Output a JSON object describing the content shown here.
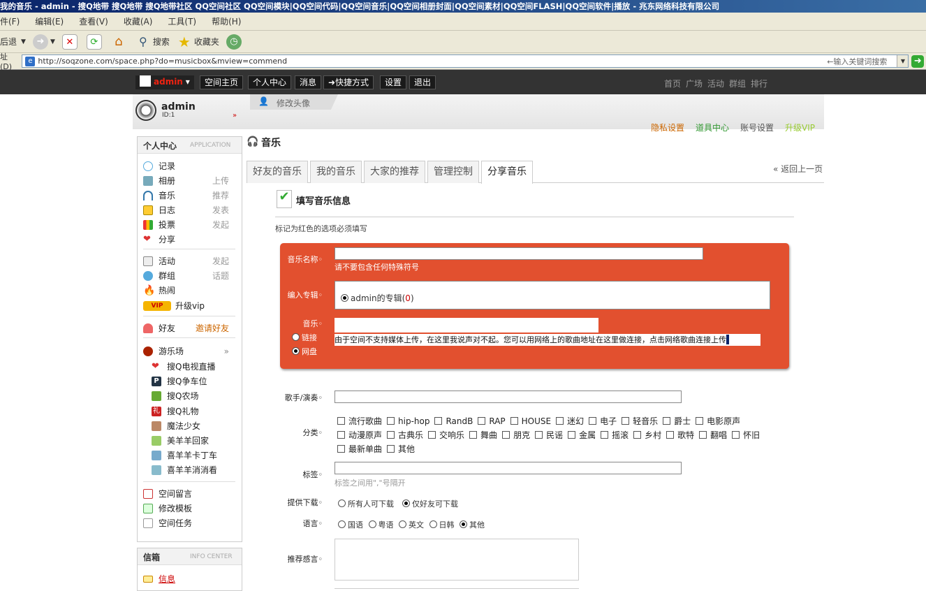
{
  "window": {
    "title": "我的音乐 - admin - 搜Q地带 搜Q地带 搜Q地带社区 QQ空间社区 QQ空间模块|QQ空间代码|QQ空间音乐|QQ空间相册封面|QQ空间素材|QQ空间FLASH|QQ空间软件|播放 - 兆东网络科技有限公司"
  },
  "menu": [
    "件(F)",
    "编辑(E)",
    "查看(V)",
    "收藏(A)",
    "工具(T)",
    "帮助(H)"
  ],
  "toolbar": {
    "back": "后退",
    "search": "搜索",
    "favorites": "收藏夹"
  },
  "address": {
    "label": "址(D)",
    "url": "http://soqzone.com/space.php?do=musicbox&mview=commend",
    "search_hint": "←输入关键词搜索"
  },
  "topnav": {
    "user": "admin",
    "buttons": [
      "空间主页",
      "个人中心",
      "消息",
      "➜快捷方式",
      "设置",
      "退出"
    ],
    "links": [
      "首页",
      "广场",
      "活动",
      "群组",
      "排行"
    ]
  },
  "header": {
    "username": "admin",
    "uid": "ID:1",
    "change_avatar": "修改头像",
    "links": [
      "隐私设置",
      "道具中心",
      "账号设置",
      "升级VIP"
    ]
  },
  "sidebar": {
    "title": "个人中心",
    "subtitle": "APPLICATION",
    "items": [
      {
        "label": "记录",
        "action": ""
      },
      {
        "label": "相册",
        "action": "上传"
      },
      {
        "label": "音乐",
        "action": "推荐"
      },
      {
        "label": "日志",
        "action": "发表"
      },
      {
        "label": "投票",
        "action": "发起"
      },
      {
        "label": "分享",
        "action": ""
      }
    ],
    "items2": [
      {
        "label": "活动",
        "action": "发起"
      },
      {
        "label": "群组",
        "action": "话题"
      },
      {
        "label": "热闹",
        "action": ""
      },
      {
        "label": "升级vip",
        "action": ""
      }
    ],
    "friends": {
      "label": "好友",
      "action": "邀请好友"
    },
    "playground": "游乐场",
    "games": [
      "搜Q电视直播",
      "搜Q争车位",
      "搜Q农场",
      "搜Q礼物",
      "魔法少女",
      "美羊羊回家",
      "喜羊羊卡丁车",
      "喜羊羊消消看"
    ],
    "bottom": [
      "空间留言",
      "修改模板",
      "空间任务"
    ],
    "info_title": "信箱",
    "info_sub": "INFO CENTER",
    "info_item": "信息"
  },
  "main": {
    "title": "音乐",
    "back": "« 返回上一页",
    "tabs": [
      "好友的音乐",
      "我的音乐",
      "大家的推荐",
      "管理控制",
      "分享音乐"
    ],
    "form_title": "填写音乐信息",
    "required_note": "标记为红色的选项必须填写",
    "name_label": "音乐名称",
    "name_hint": "请不要包含任何特殊符号",
    "album_label": "编入专辑",
    "album_option": "admin的专辑(",
    "album_count": "0",
    "album_close": ")",
    "music_label": "音乐",
    "link_opt": "链接",
    "disk_opt": "网盘",
    "music_note": "由于空间不支持媒体上传，在这里我说声对不起。您可以用网络上的歌曲地址在这里做连接，点击网络歌曲连接上传",
    "singer_label": "歌手/演奏",
    "category_label": "分类",
    "categories": [
      "流行歌曲",
      "hip-hop",
      "RandB",
      "RAP",
      "HOUSE",
      "迷幻",
      "电子",
      "轻音乐",
      "爵士",
      "电影原声",
      "动漫原声",
      "古典乐",
      "交响乐",
      "舞曲",
      "朋克",
      "民谣",
      "金属",
      "摇滚",
      "乡村",
      "歌特",
      "翻唱",
      "怀旧",
      "最新单曲",
      "其他"
    ],
    "tag_label": "标签",
    "tag_hint": "标签之间用\",\"号隔开",
    "download_label": "提供下载",
    "download_opts": [
      "所有人可下载",
      "仅好友可下载"
    ],
    "lang_label": "语言",
    "lang_opts": [
      "国语",
      "粤语",
      "英文",
      "日韩",
      "其他"
    ],
    "recommend_label": "推荐感言"
  }
}
